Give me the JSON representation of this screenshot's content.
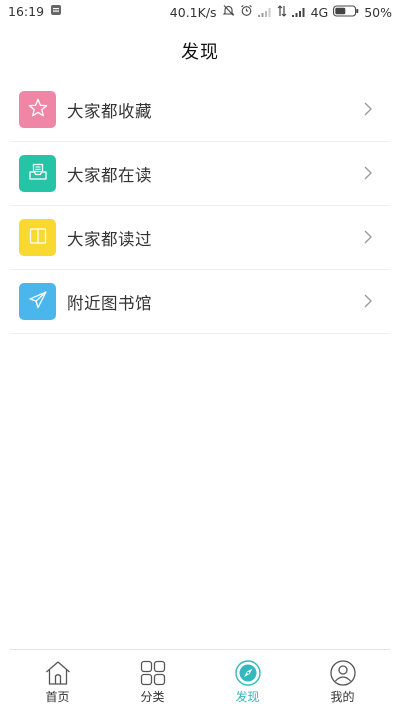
{
  "status_bar": {
    "time": "16:19",
    "net_speed": "40.1K/s",
    "network_type": "4G",
    "battery": "50%"
  },
  "header": {
    "title": "发现"
  },
  "list": {
    "items": [
      {
        "label": "大家都收藏",
        "icon": "star-icon",
        "color": "#ef86a6"
      },
      {
        "label": "大家都在读",
        "icon": "inbox-book-icon",
        "color": "#25c4a6"
      },
      {
        "label": "大家都读过",
        "icon": "open-book-icon",
        "color": "#f9d930"
      },
      {
        "label": "附近图书馆",
        "icon": "paper-plane-icon",
        "color": "#4bb6ec"
      }
    ]
  },
  "bottom_nav": {
    "active_color": "#35b8bd",
    "items": [
      {
        "label": "首页",
        "icon": "home-icon"
      },
      {
        "label": "分类",
        "icon": "grid-icon"
      },
      {
        "label": "发现",
        "icon": "compass-icon",
        "active": true
      },
      {
        "label": "我的",
        "icon": "user-icon"
      }
    ]
  }
}
